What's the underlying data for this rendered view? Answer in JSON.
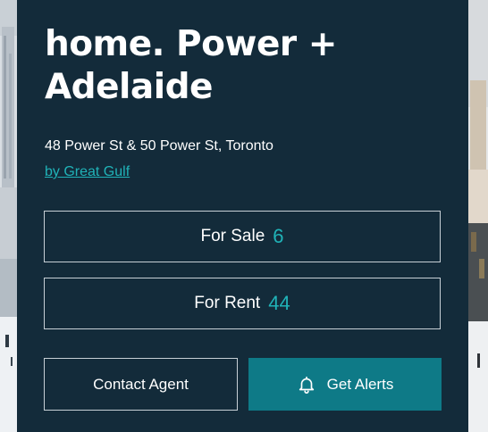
{
  "listing": {
    "title": "home. Power + Adelaide",
    "address": "48 Power St & 50 Power St, Toronto",
    "developer_link": "by Great Gulf"
  },
  "counts": {
    "for_sale_label": "For Sale",
    "for_sale_count": "6",
    "for_rent_label": "For Rent",
    "for_rent_count": "44"
  },
  "actions": {
    "contact_label": "Contact Agent",
    "alerts_label": "Get Alerts",
    "alerts_icon": "bell-icon"
  },
  "colors": {
    "panel_bg": "#132b3a",
    "accent": "#20b3b8",
    "alerts_button": "#0e7a87"
  }
}
